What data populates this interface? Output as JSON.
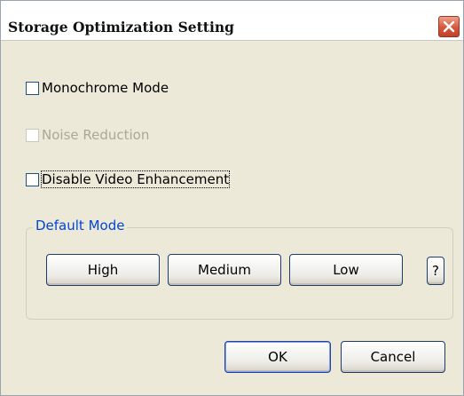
{
  "window": {
    "title": "Storage Optimization Setting"
  },
  "options": {
    "monochrome": {
      "label": "Monochrome Mode",
      "checked": false,
      "enabled": true
    },
    "noise_reduction": {
      "label": "Noise Reduction",
      "checked": false,
      "enabled": false
    },
    "disable_video_enhancement": {
      "label": "Disable Video Enhancement",
      "checked": false,
      "enabled": true
    }
  },
  "default_mode": {
    "legend": "Default Mode",
    "buttons": {
      "high": "High",
      "medium": "Medium",
      "low": "Low",
      "help": "?"
    }
  },
  "footer": {
    "ok": "OK",
    "cancel": "Cancel"
  },
  "colors": {
    "legend_text": "#0046d5",
    "disabled_text": "#aca899",
    "dialog_bg": "#ece9d8",
    "close_button": "#d6573a"
  },
  "icons": {
    "close": "close-icon"
  }
}
